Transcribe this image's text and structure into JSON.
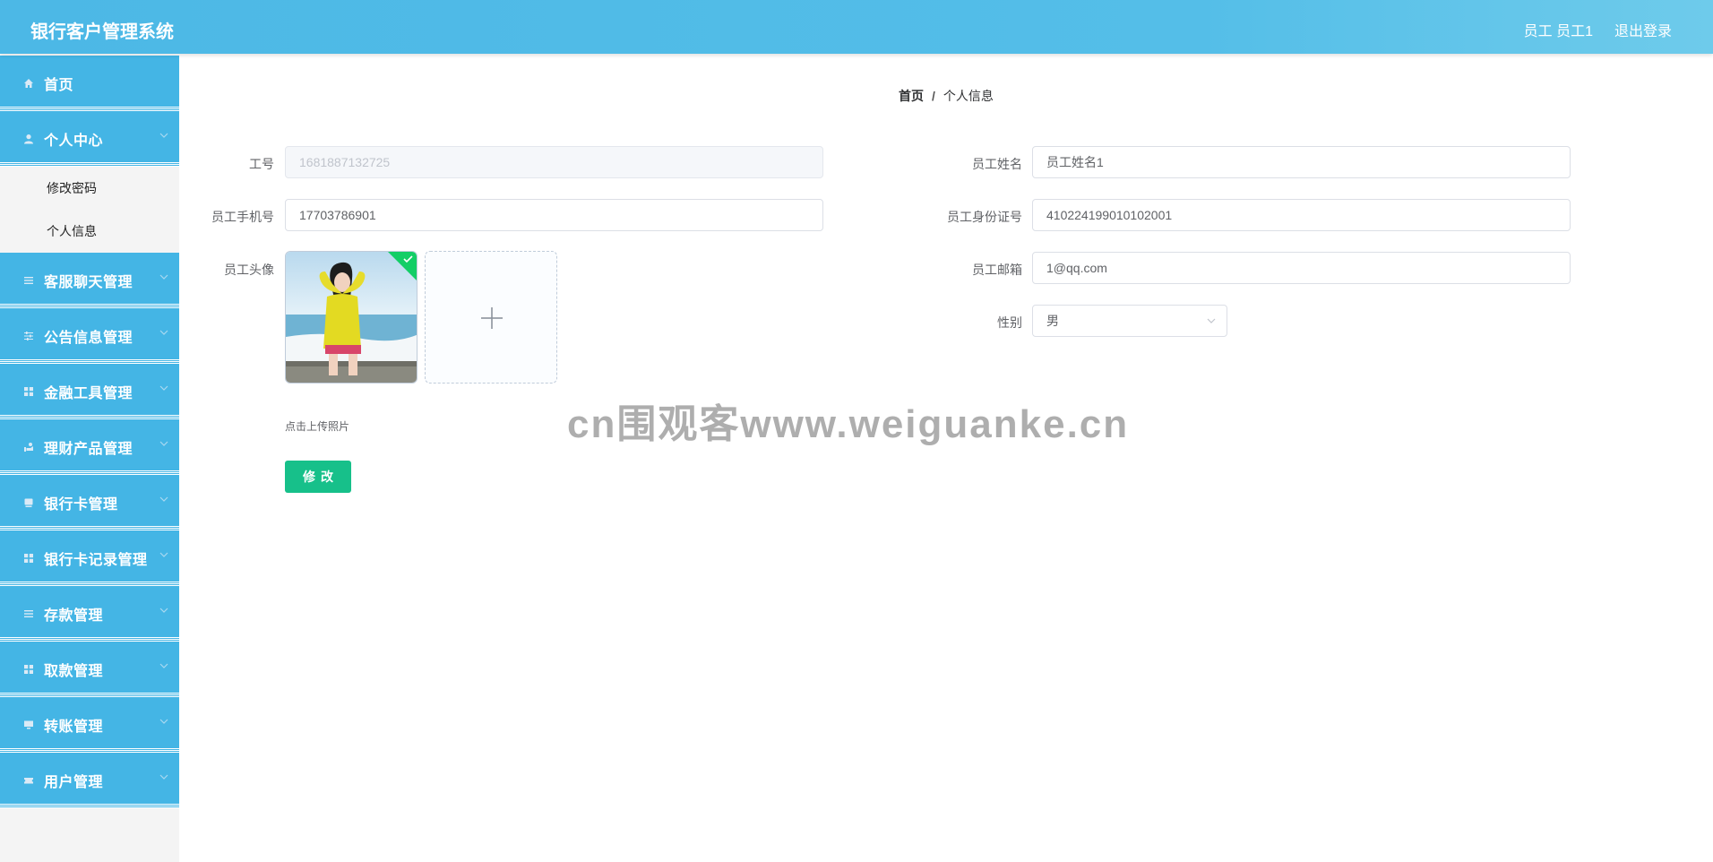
{
  "header": {
    "app_title": "银行客户管理系统",
    "user_info": "员工 员工1",
    "logout_label": "退出登录"
  },
  "sidebar": {
    "items": [
      {
        "label": "首页",
        "icon": "home-icon",
        "expandable": false
      },
      {
        "label": "个人中心",
        "icon": "user-icon",
        "expandable": true,
        "children": [
          {
            "label": "修改密码"
          },
          {
            "label": "个人信息"
          }
        ]
      },
      {
        "label": "客服聊天管理",
        "icon": "menu-lines-icon",
        "expandable": true
      },
      {
        "label": "公告信息管理",
        "icon": "sliders-icon",
        "expandable": true
      },
      {
        "label": "金融工具管理",
        "icon": "grid-icon",
        "expandable": true
      },
      {
        "label": "理财产品管理",
        "icon": "hand-coin-icon",
        "expandable": true
      },
      {
        "label": "银行卡管理",
        "icon": "card-icon",
        "expandable": true
      },
      {
        "label": "银行卡记录管理",
        "icon": "grid-icon",
        "expandable": true
      },
      {
        "label": "存款管理",
        "icon": "menu-lines-icon",
        "expandable": true
      },
      {
        "label": "取款管理",
        "icon": "grid-icon",
        "expandable": true
      },
      {
        "label": "转账管理",
        "icon": "monitor-icon",
        "expandable": true
      },
      {
        "label": "用户管理",
        "icon": "ticket-icon",
        "expandable": true
      }
    ]
  },
  "breadcrumb": {
    "home": "首页",
    "separator": "/",
    "current": "个人信息"
  },
  "form": {
    "employee_no_label": "工号",
    "employee_no_value": "1681887132725",
    "name_label": "员工姓名",
    "name_value": "员工姓名1",
    "phone_label": "员工手机号",
    "phone_value": "17703786901",
    "id_card_label": "员工身份证号",
    "id_card_value": "410224199010102001",
    "avatar_label": "员工头像",
    "email_label": "员工邮箱",
    "email_value": "1@qq.com",
    "gender_label": "性别",
    "gender_value": "男",
    "upload_hint": "点击上传照片",
    "submit_label": "修改"
  },
  "watermark": "cn围观客www.weiguanke.cn",
  "colors": {
    "header": "#4cb8e6",
    "sidebar_item": "#44b5e5",
    "submit": "#17c08a",
    "upload_success": "#13ce66"
  }
}
